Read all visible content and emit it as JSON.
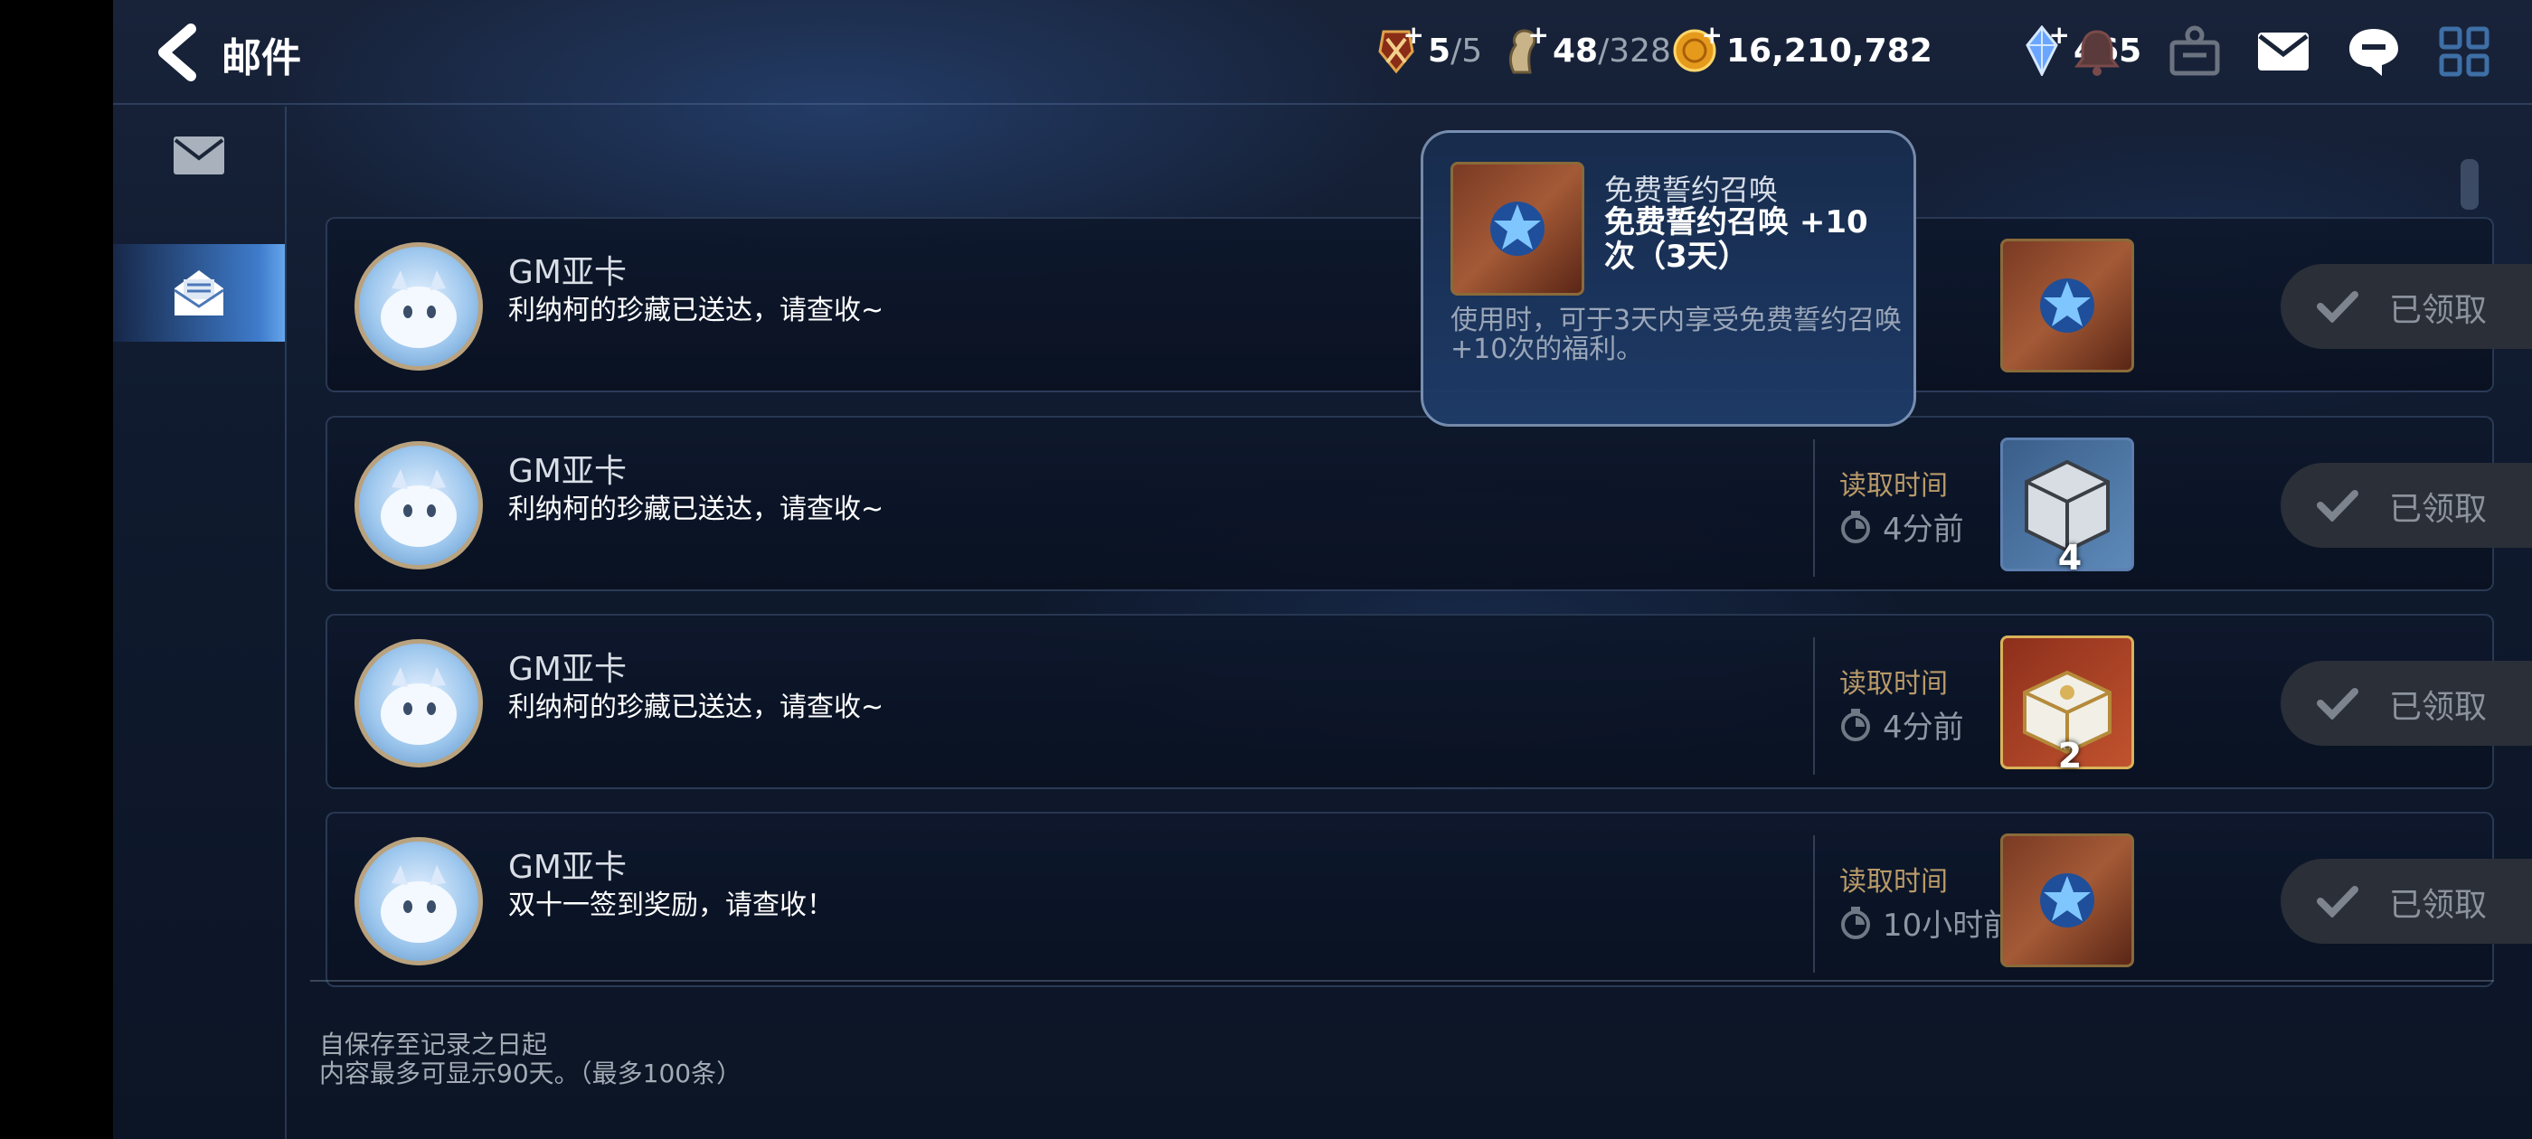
{
  "header": {
    "title": "邮件",
    "resources": [
      {
        "icon": "stamina-sword-icon",
        "value": "5",
        "max": "/5"
      },
      {
        "icon": "horse-stamina-icon",
        "value": "48",
        "max": "/328"
      },
      {
        "icon": "gold-coin-icon",
        "value": "16,210,782",
        "max": ""
      },
      {
        "icon": "crystal-gem-icon",
        "value": "465",
        "max": ""
      }
    ],
    "icons": [
      "bell-icon",
      "guild-icon",
      "mail-icon",
      "chat-icon",
      "menu-grid-icon"
    ]
  },
  "sidebar": {
    "tabs": [
      {
        "icon": "envelope-icon",
        "active": false
      },
      {
        "icon": "open-envelope-icon",
        "active": true
      }
    ]
  },
  "mails": [
    {
      "sender": "GM亚卡",
      "subject": "利纳柯的珍藏已送达，请查收~",
      "read_label": "",
      "read_time": "",
      "reward": "book",
      "reward_count": "",
      "claim_label": "已领取"
    },
    {
      "sender": "GM亚卡",
      "subject": "利纳柯的珍藏已送达，请查收~",
      "read_label": "读取时间",
      "read_time": "4分前",
      "reward": "cube",
      "reward_count": "4",
      "claim_label": "已领取"
    },
    {
      "sender": "GM亚卡",
      "subject": "利纳柯的珍藏已送达，请查收~",
      "read_label": "读取时间",
      "read_time": "4分前",
      "reward": "chest",
      "reward_count": "2",
      "claim_label": "已领取"
    },
    {
      "sender": "GM亚卡",
      "subject": "双十一签到奖励，请查收！",
      "read_label": "读取时间",
      "read_time": "10小时前",
      "reward": "book",
      "reward_count": "",
      "claim_label": "已领取"
    }
  ],
  "tooltip": {
    "name": "免费誓约召唤",
    "title": "免费誓约召唤 +10次（3天）",
    "description": "使用时，可于3天内享受免费誓约召唤+10次的福利。"
  },
  "footer": {
    "line1": "自保存至记录之日起",
    "line2": "内容最多可显示90天。（最多100条）"
  }
}
